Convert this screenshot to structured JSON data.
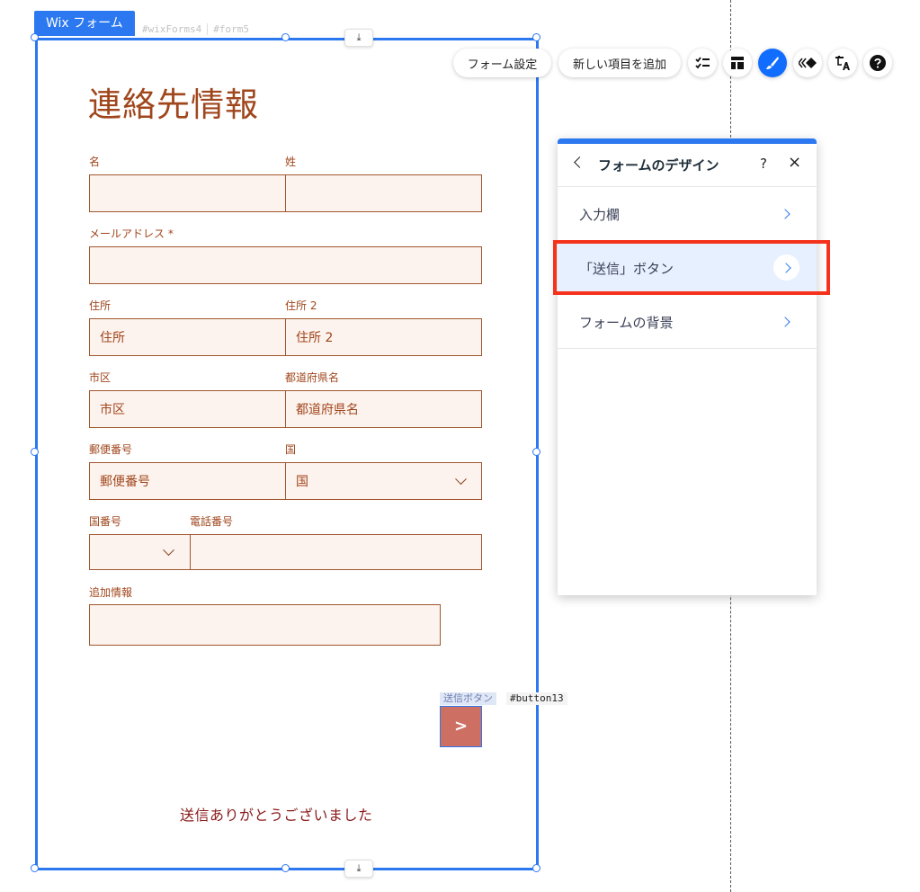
{
  "widget_tag": "Wix フォーム",
  "id_tags": [
    "#wixForms4",
    "#form5"
  ],
  "download_glyph": "⤓",
  "form": {
    "title": "連絡先情報",
    "labels": {
      "first_name": "名",
      "last_name": "姓",
      "email": "メールアドレス *",
      "address": "住所",
      "address2": "住所 2",
      "city": "市区",
      "prefecture": "都道府県名",
      "postal": "郵便番号",
      "country": "国",
      "country_code": "国番号",
      "phone": "電話番号",
      "notes": "追加情報"
    },
    "placeholders": {
      "first_name": "",
      "last_name": "",
      "email": "",
      "address": "住所",
      "address2": "住所 2",
      "city": "市区",
      "prefecture": "都道府県名",
      "postal": "郵便番号",
      "country": "国",
      "country_code": "",
      "phone": "",
      "notes": ""
    },
    "submit_tag": "送信ボタン",
    "submit_id": "#button13",
    "submit_label": ">",
    "thanks_message": "送信ありがとうございました"
  },
  "toolbar": {
    "form_settings": "フォーム設定",
    "add_item": "新しい項目を追加",
    "icons": [
      "fields-list-icon",
      "layout-icon",
      "design-brush-icon",
      "animation-icon",
      "translate-icon",
      "help-icon"
    ]
  },
  "panel": {
    "title": "フォームのデザイン",
    "help": "?",
    "close": "×",
    "items": [
      {
        "label": "入力欄"
      },
      {
        "label": "「送信」ボタン"
      },
      {
        "label": "フォームの背景"
      }
    ]
  },
  "colors": {
    "accent": "#2b78f0",
    "form_text": "#a0461c",
    "field_bg": "#fdf3ee",
    "submit_bg": "#cd7063",
    "highlight": "#f5321b"
  }
}
